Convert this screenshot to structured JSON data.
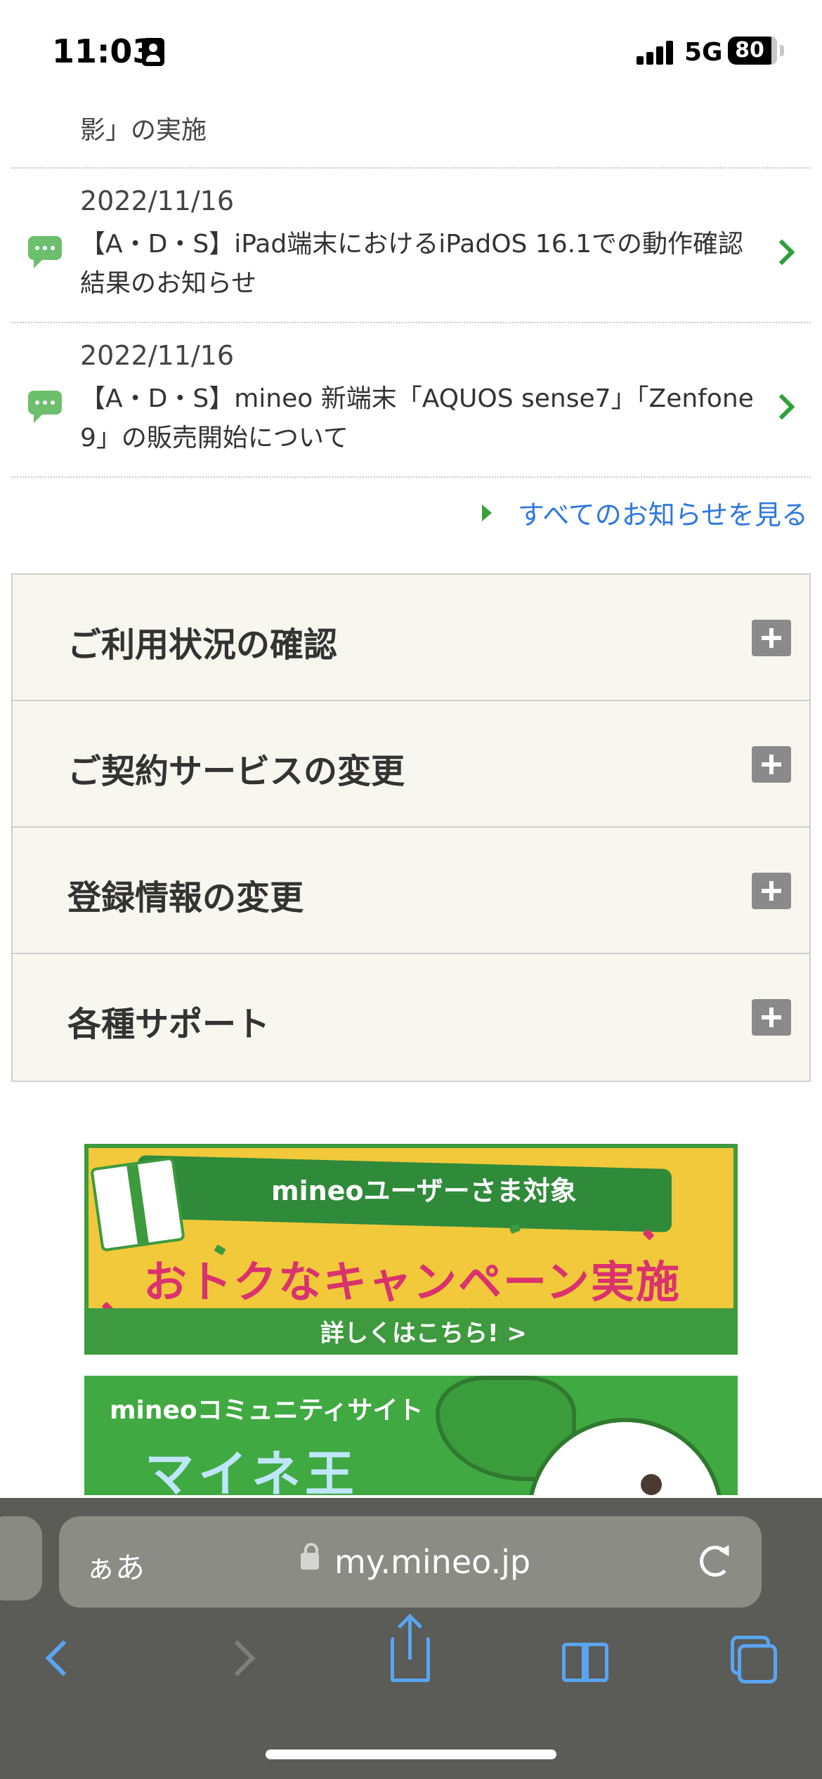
{
  "status_bar": {
    "time": "11:03",
    "network": "5G",
    "battery": "80"
  },
  "news": {
    "partial_item_tail": "影」の実施",
    "items": [
      {
        "date": "2022/11/16",
        "title": "【A・D・S】iPad端末におけるiPadOS 16.1での動作確認結果のお知らせ"
      },
      {
        "date": "2022/11/16",
        "title": "【A・D・S】mineo 新端末「AQUOS sense7」「Zenfone 9」の販売開始について"
      }
    ],
    "see_all_label": "すべてのお知らせを見る"
  },
  "menu": {
    "items": [
      {
        "label": "ご利用状況の確認"
      },
      {
        "label": "ご契約サービスの変更"
      },
      {
        "label": "登録情報の変更"
      },
      {
        "label": "各種サポート"
      }
    ]
  },
  "banners": {
    "campaign": {
      "ribbon": "mineoユーザーさま対象",
      "headline": "おトクなキャンペーン実施中!",
      "footer": "詳しくはこちら! >"
    },
    "community": {
      "label": "mineoコミュニティサイト",
      "logo": "マイネ王"
    }
  },
  "browser": {
    "aa_label": "ぁあ",
    "url": "my.mineo.jp"
  },
  "colors": {
    "accent_green": "#2fa03c",
    "link_blue": "#2e78e0",
    "accordion_bg": "#f8f7ef",
    "toolbar_bg": "#5b5b58"
  }
}
